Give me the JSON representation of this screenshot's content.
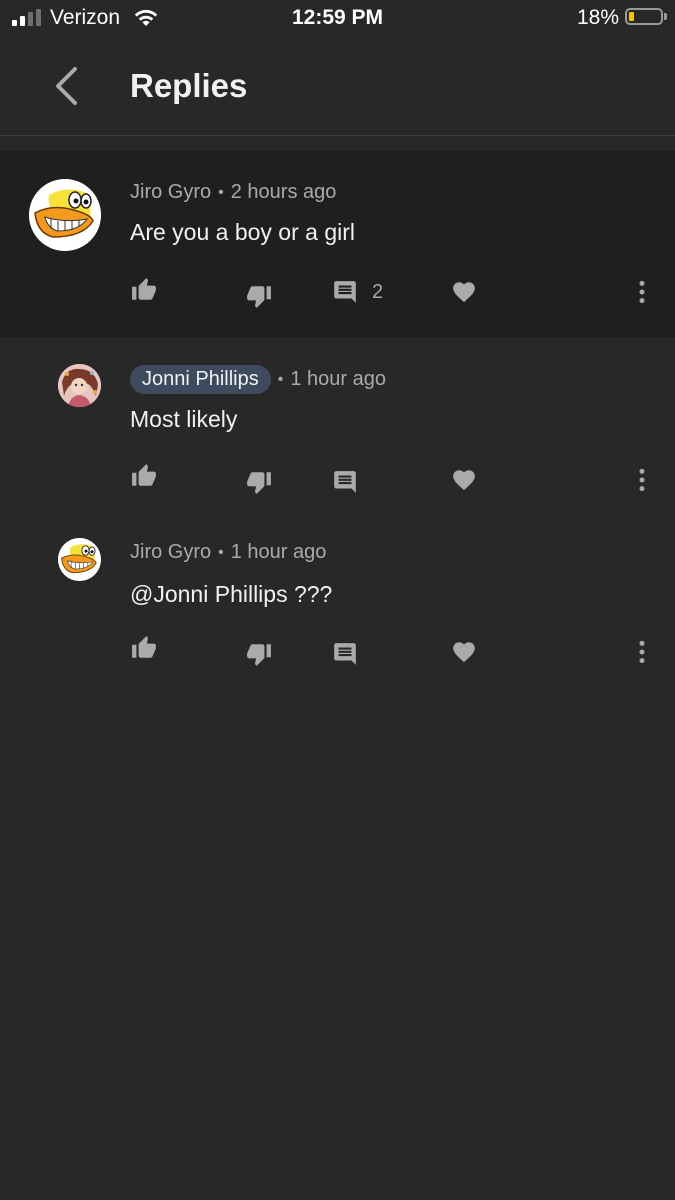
{
  "status_bar": {
    "carrier": "Verizon",
    "time": "12:59 PM",
    "battery": "18%",
    "battery_level": 0.18,
    "signal_bars_filled": 2,
    "signal_bars_total": 4
  },
  "header": {
    "title": "Replies",
    "back_icon": "chevron-left-icon"
  },
  "comments": [
    {
      "author": "Jiro Gyro",
      "time": "2 hours ago",
      "text": "Are you a boy or a girl",
      "reply_count": "2",
      "avatar": "duck-cartoon-avatar",
      "highlighted_author": false
    },
    {
      "author": "Jonni Phillips",
      "time": "1 hour ago",
      "text": "Most likely",
      "reply_count": "",
      "avatar": "illustrated-girl-avatar",
      "highlighted_author": true
    },
    {
      "author": "Jiro Gyro",
      "time": "1 hour ago",
      "text": "@Jonni Phillips ???",
      "reply_count": "",
      "avatar": "duck-cartoon-avatar",
      "highlighted_author": false
    }
  ],
  "colors": {
    "background": "#282828",
    "parent_background": "#1f1f1f",
    "author_chip": "#3e4a5e",
    "icon": "#aaaaaa",
    "text": "#f1f1f1",
    "battery_fill": "#f5c400"
  }
}
